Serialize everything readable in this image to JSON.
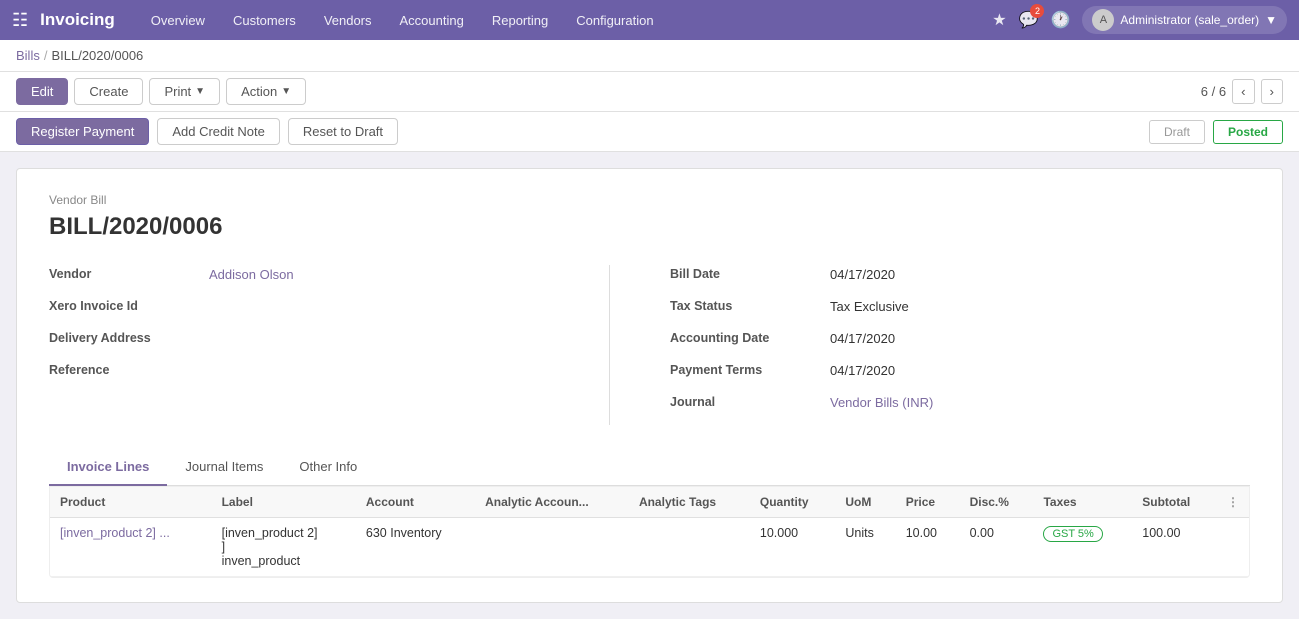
{
  "app": {
    "title": "Invoicing",
    "grid_icon": "⊞"
  },
  "nav": {
    "items": [
      {
        "label": "Overview",
        "id": "overview"
      },
      {
        "label": "Customers",
        "id": "customers"
      },
      {
        "label": "Vendors",
        "id": "vendors"
      },
      {
        "label": "Accounting",
        "id": "accounting"
      },
      {
        "label": "Reporting",
        "id": "reporting"
      },
      {
        "label": "Configuration",
        "id": "configuration"
      }
    ]
  },
  "nav_right": {
    "chat_count": "2",
    "user_label": "Administrator (sale_order)",
    "user_initials": "A"
  },
  "breadcrumb": {
    "parent": "Bills",
    "separator": "/",
    "current": "BILL/2020/0006"
  },
  "toolbar": {
    "edit_label": "Edit",
    "create_label": "Create",
    "print_label": "Print",
    "action_label": "Action",
    "pagination": "6 / 6"
  },
  "status_bar": {
    "register_payment_label": "Register Payment",
    "add_credit_note_label": "Add Credit Note",
    "reset_to_draft_label": "Reset to Draft",
    "draft_label": "Draft",
    "posted_label": "Posted"
  },
  "document": {
    "type": "Vendor Bill",
    "number": "BILL/2020/0006",
    "fields_left": {
      "vendor_label": "Vendor",
      "vendor_value": "Addison Olson",
      "xero_label": "Xero Invoice Id",
      "xero_value": "",
      "delivery_label": "Delivery Address",
      "delivery_value": "",
      "reference_label": "Reference",
      "reference_value": ""
    },
    "fields_right": {
      "bill_date_label": "Bill Date",
      "bill_date_value": "04/17/2020",
      "tax_status_label": "Tax Status",
      "tax_status_value": "Tax Exclusive",
      "accounting_date_label": "Accounting Date",
      "accounting_date_value": "04/17/2020",
      "payment_terms_label": "Payment Terms",
      "payment_terms_value": "04/17/2020",
      "journal_label": "Journal",
      "journal_value": "Vendor Bills (INR)"
    }
  },
  "tabs": [
    {
      "label": "Invoice Lines",
      "id": "invoice-lines",
      "active": true
    },
    {
      "label": "Journal Items",
      "id": "journal-items",
      "active": false
    },
    {
      "label": "Other Info",
      "id": "other-info",
      "active": false
    }
  ],
  "table": {
    "columns": [
      {
        "label": "Product",
        "id": "product"
      },
      {
        "label": "Label",
        "id": "label"
      },
      {
        "label": "Account",
        "id": "account"
      },
      {
        "label": "Analytic Accoun...",
        "id": "analytic-account"
      },
      {
        "label": "Analytic Tags",
        "id": "analytic-tags"
      },
      {
        "label": "Quantity",
        "id": "quantity"
      },
      {
        "label": "UoM",
        "id": "uom"
      },
      {
        "label": "Price",
        "id": "price"
      },
      {
        "label": "Disc.%",
        "id": "disc"
      },
      {
        "label": "Taxes",
        "id": "taxes"
      },
      {
        "label": "Subtotal",
        "id": "subtotal"
      }
    ],
    "rows": [
      {
        "product": "[inven_product 2] ...",
        "label_line1": "[inven_product 2]",
        "label_line2": "]",
        "label_line3": "inven_product",
        "account": "630 Inventory",
        "analytic_account": "",
        "analytic_tags": "",
        "quantity": "10.000",
        "uom": "Units",
        "price": "10.00",
        "disc": "0.00",
        "taxes": "GST 5%",
        "subtotal": "100.00"
      }
    ]
  }
}
